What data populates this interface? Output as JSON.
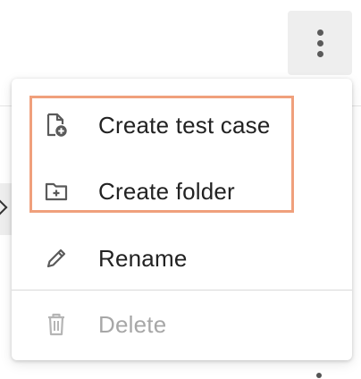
{
  "header": {
    "more_button_icon": "kebab-vertical-icon"
  },
  "menu": {
    "items": [
      {
        "label": "Create test case",
        "icon": "file-plus-icon",
        "disabled": false
      },
      {
        "label": "Create folder",
        "icon": "folder-plus-icon",
        "disabled": false
      },
      {
        "label": "Rename",
        "icon": "pencil-icon",
        "disabled": false
      },
      {
        "label": "Delete",
        "icon": "trash-icon",
        "disabled": true
      }
    ]
  },
  "colors": {
    "text": "#222222",
    "disabled_text": "#a7a7a7",
    "icon": "#5a5a5a",
    "disabled_icon": "#b5b5b5",
    "highlight": "#f0a07c",
    "more_button_bg": "#eeeeee"
  }
}
